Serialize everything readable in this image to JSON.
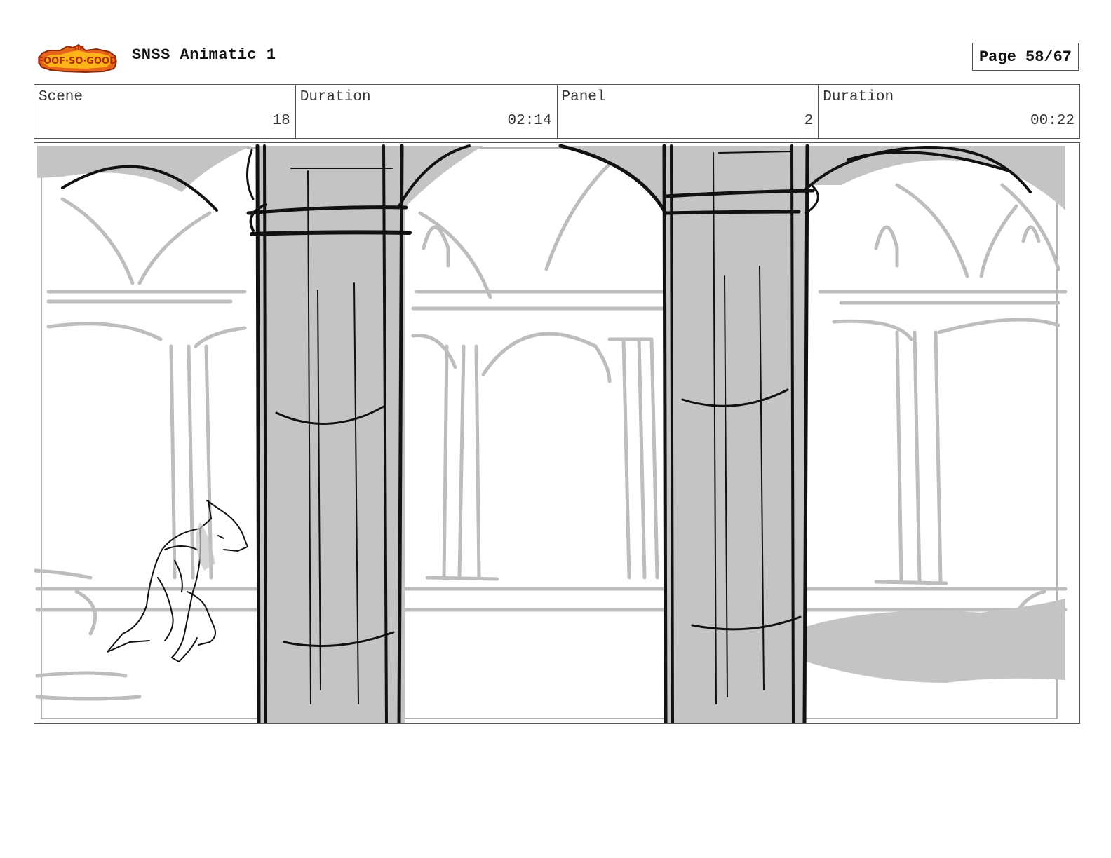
{
  "header": {
    "logo_text": "Sir Foof-So-Good",
    "title": "SNSS Animatic 1",
    "page_label": "Page 58/67"
  },
  "info": {
    "scene_label": "Scene",
    "scene_value": "18",
    "scene_duration_label": "Duration",
    "scene_duration_value": "02:14",
    "panel_label": "Panel",
    "panel_value": "2",
    "panel_duration_label": "Duration",
    "panel_duration_value": "00:22"
  },
  "panel_image": {
    "description_icon": "storyboard-sketch-colonnade"
  },
  "colors": {
    "sketch_gray": "#c4c4c4",
    "ink": "#111111",
    "logo_orange": "#e8641a",
    "logo_yellow": "#ffc21a"
  }
}
